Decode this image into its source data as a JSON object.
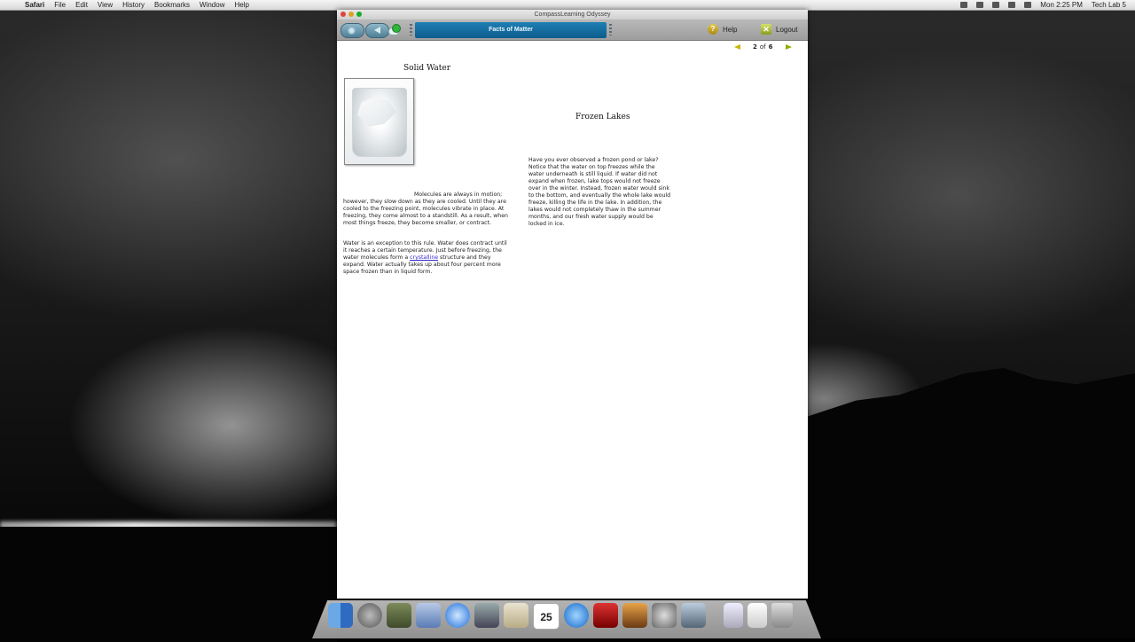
{
  "menubar": {
    "app": "Safari",
    "items": [
      "File",
      "Edit",
      "View",
      "History",
      "Bookmarks",
      "Window",
      "Help"
    ],
    "clock": "Mon 2:25 PM",
    "user": "Tech Lab 5"
  },
  "window": {
    "title": "CompassLearning Odyssey"
  },
  "toolbar": {
    "tab_title": "Facts of Matter",
    "help_label": "Help",
    "logout_label": "Logout"
  },
  "pager": {
    "current": "2",
    "of": "of",
    "total": "6"
  },
  "content": {
    "solid": {
      "title": "Solid Water",
      "para1": "Molecules are always in motion; however, they slow down as they are cooled. Until they are cooled to the freezing point, molecules vibrate in place. At freezing, they come almost to a standstill. As a result, when most things freeze, they become smaller, or contract.",
      "para2_before": "Water is an exception to this rule. Water does contract until it reaches a certain temperature. Just before freezing, the water molecules form a ",
      "para2_link": "crystalline",
      "para2_after": " structure and they expand. Water actually takes up about four percent more space frozen than in liquid form."
    },
    "frozen": {
      "title": "Frozen Lakes",
      "para": "Have you ever observed a frozen pond or lake? Notice that the water on top freezes while the water underneath is still liquid. If water did not expand when frozen, lake tops would not freeze over in the winter. Instead, frozen water would sink to the bottom, and eventually the whole lake would freeze, killing the life in the lake. In addition, the lakes would not completely thaw in the summer months, and our fresh water supply would be locked in ice."
    }
  },
  "dock": {
    "calendar_day": "25"
  },
  "colors": {
    "tab_blue": "#1f7fb3",
    "link": "#3a2ccf",
    "prev_arrow": "#c9b700",
    "next_arrow": "#8fae00"
  }
}
